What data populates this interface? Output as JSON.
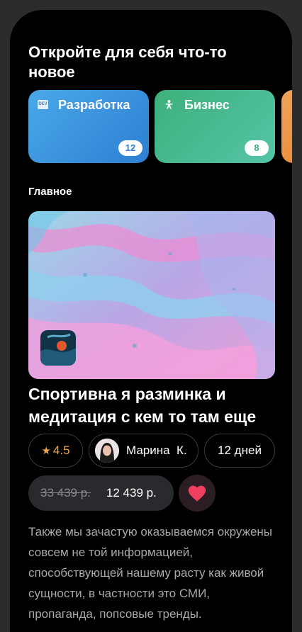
{
  "header": {
    "title": "Откройте для себя что-то новое"
  },
  "categories": [
    {
      "label": "Разработка",
      "count": "12",
      "icon": "dev-icon",
      "icon_text": "DEV",
      "color": "#2d7fd2"
    },
    {
      "label": "Бизнес",
      "count": "8",
      "icon": "person-icon",
      "color": "#3db07a"
    }
  ],
  "section": {
    "label": "Главное"
  },
  "course": {
    "title": "Спортивна я разминка и медитация с кем то там еще",
    "rating": "4.5",
    "author": "Марина  К.",
    "duration": "12 дней",
    "old_price": "33 439 р.",
    "price": "12 439 р.",
    "description": "Также мы зачастую оказываемся окружены совсем не той информацией, способствующей нашему расту как живой сущности, в частности это СМИ, пропаганда, попсовые тренды."
  },
  "colors": {
    "accent_rating": "#f0a54a",
    "heart": "#ef3f5f",
    "background": "#000000"
  }
}
